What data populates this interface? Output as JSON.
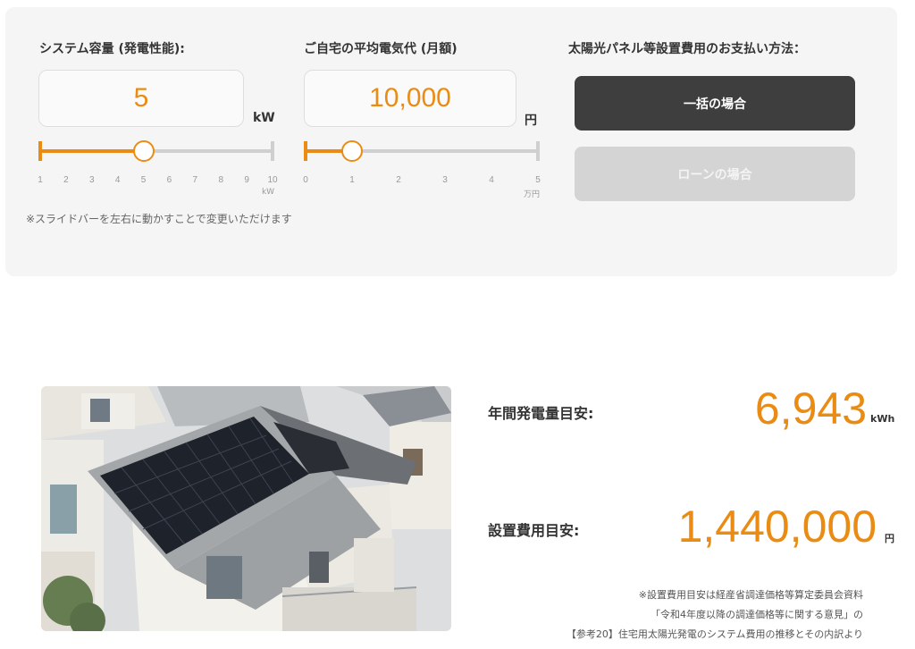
{
  "capacity": {
    "title": "システム容量 (発電性能):",
    "value": "5",
    "unit": "kW",
    "ticks": [
      "1",
      "2",
      "3",
      "4",
      "5",
      "6",
      "7",
      "8",
      "9",
      "10"
    ],
    "tick_unit": "kW",
    "slider_min": 1,
    "slider_max": 10,
    "slider_value": 5
  },
  "bill": {
    "title": "ご自宅の平均電気代 (月額)",
    "value": "10,000",
    "unit": "円",
    "ticks": [
      "0",
      "1",
      "2",
      "3",
      "4",
      "5"
    ],
    "tick_unit": "万円",
    "slider_min": 0,
    "slider_max": 5,
    "slider_value": 1
  },
  "payment": {
    "title": "太陽光パネル等設置費用のお支払い方法：",
    "lump_label": "一括の場合",
    "loan_label": "ローンの場合"
  },
  "slider_note": "※スライドバーを左右に動かすことで変更いただけます",
  "results": {
    "annual_label": "年間発電量目安:",
    "annual_value": "6,943",
    "annual_unit": "kWh",
    "cost_label": "設置費用目安:",
    "cost_value": "1,440,000",
    "cost_unit": "円"
  },
  "source_notes": [
    "※設置費用目安は経産省調達価格等算定委員会資料",
    "「令和4年度以降の調達価格等に関する意見」の",
    "【参考20】住宅用太陽光発電のシステム費用の推移とその内訳より"
  ],
  "colors": {
    "accent": "#ea8c14",
    "dark_button": "#3e3e3e",
    "panel_bg": "#f5f5f5"
  }
}
